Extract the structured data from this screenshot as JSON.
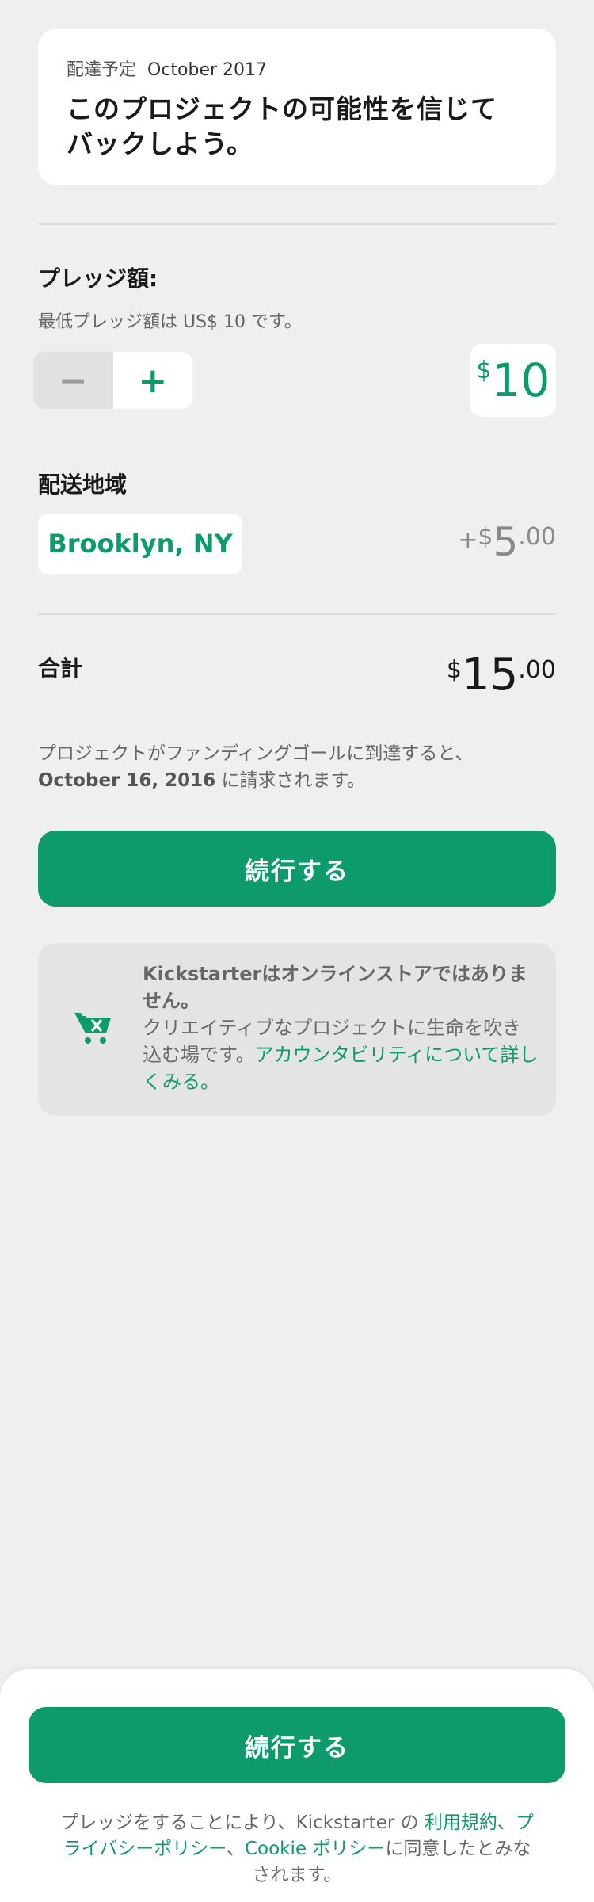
{
  "reward": {
    "delivery_label": "配達予定",
    "delivery_date": "October 2017",
    "title_line1": "このプロジェクトの可能性を信じて",
    "title_line2": "バックしよう。"
  },
  "pledge": {
    "title": "プレッジ額:",
    "minimum_note": "最低プレッジ額は US$ 10 です。",
    "minus_symbol": "−",
    "plus_symbol": "+",
    "currency_symbol": "$",
    "amount": "10"
  },
  "shipping": {
    "title": "配送地域",
    "location": "Brooklyn, NY",
    "cost_prefix": "+",
    "cost_currency": "$",
    "cost_whole": "5",
    "cost_cents": ".00"
  },
  "total": {
    "label": "合計",
    "currency": "$",
    "whole": "15",
    "cents": ".00"
  },
  "charge_note": {
    "line1": "プロジェクトがファンディングゴールに到達すると、",
    "date": "October 16, 2016",
    "line2_suffix": " に請求されます。"
  },
  "continue_button_label": "続行する",
  "info": {
    "icon": "shopping-cart-x-icon",
    "text_strong": "Kickstarterはオンラインストアではありません。",
    "text_body": "クリエイティブなプロジェクトに生命を吹き込む場です。",
    "link_text": "アカウンタビリティについて詳しくみる。"
  },
  "bottom": {
    "button_label": "続行する",
    "terms_prefix": "プレッジをすることにより、Kickstarter の ",
    "terms_link": "利用規約",
    "sep1": "、",
    "privacy_link": "プライバシーポリシー",
    "sep2": "、",
    "cookie_link": "Cookie ポリシー",
    "terms_suffix": "に同意したとみなされます。"
  },
  "colors": {
    "accent": "#0d9b6b",
    "background": "#efefef",
    "card": "#ffffff"
  }
}
